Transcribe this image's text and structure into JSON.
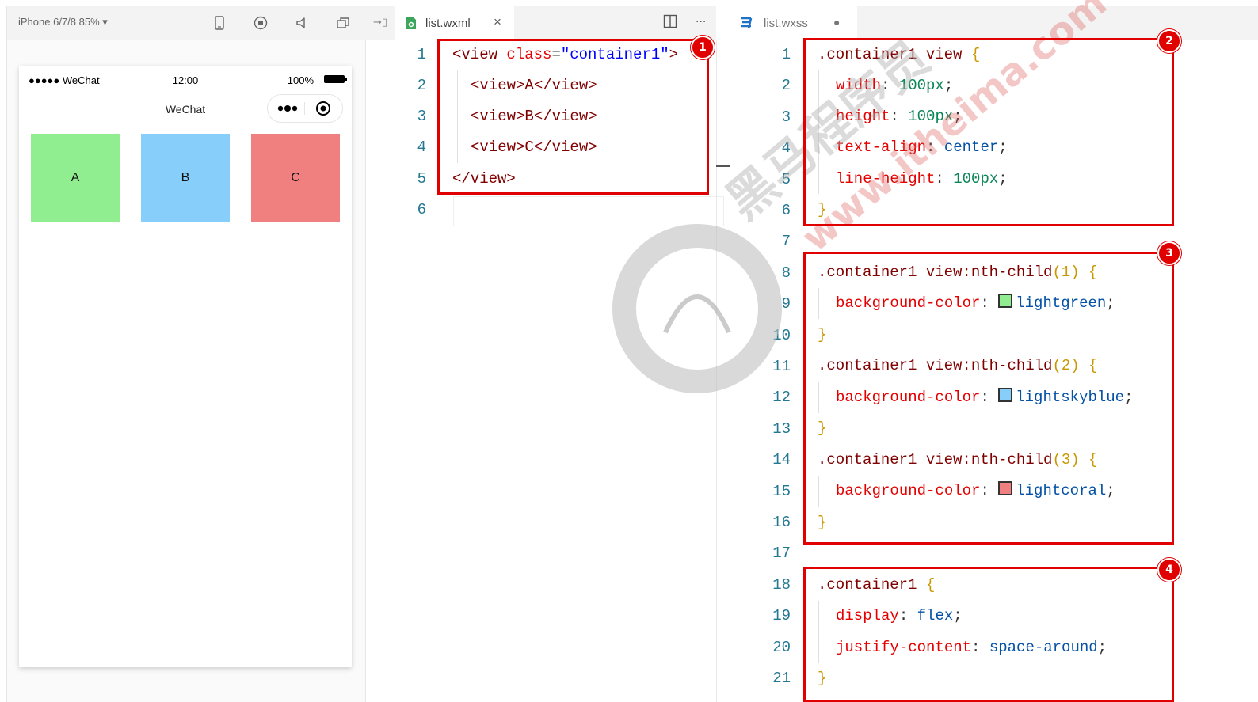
{
  "simulator": {
    "device_label": "iPhone 6/7/8 85% ▾",
    "status": {
      "carrier": "●●●●● WeChat",
      "time": "12:00",
      "battery": "100%"
    },
    "nav_title": "WeChat",
    "boxes": [
      {
        "label": "A",
        "color": "#90ee90"
      },
      {
        "label": "B",
        "color": "#87cefa"
      },
      {
        "label": "C",
        "color": "#f08080"
      }
    ]
  },
  "wxml_editor": {
    "tab": {
      "label": "list.wxml",
      "close": "×"
    },
    "line_numbers": [
      "1",
      "2",
      "3",
      "4",
      "5",
      "6"
    ],
    "code": {
      "l1": {
        "open": "<view ",
        "attr": "class",
        "eq": "=",
        "value": "\"container1\"",
        "close": ">"
      },
      "l2": "<view>A</view>",
      "l3": "<view>B</view>",
      "l4": "<view>C</view>",
      "l5": "</view>"
    },
    "more": "···"
  },
  "wxss_editor": {
    "tab": {
      "label": "list.wxss",
      "modified": "●"
    },
    "line_numbers": [
      "1",
      "2",
      "3",
      "4",
      "5",
      "6",
      "7",
      "8",
      "9",
      "10",
      "11",
      "12",
      "13",
      "14",
      "15",
      "16",
      "17",
      "18",
      "19",
      "20",
      "21"
    ],
    "code": {
      "l1_selector": ".container1 view",
      "l2": {
        "prop": "width",
        "value": "100px"
      },
      "l3": {
        "prop": "height",
        "value": "100px"
      },
      "l4": {
        "prop": "text-align",
        "value": "center"
      },
      "l5": {
        "prop": "line-height",
        "value": "100px"
      },
      "l8_selector": ".container1 view:nth-child",
      "l8_arg": "(1)",
      "l9": {
        "prop": "background-color",
        "value": "lightgreen",
        "swatch": "#90ee90"
      },
      "l11_selector": ".container1 view:nth-child",
      "l11_arg": "(2)",
      "l12": {
        "prop": "background-color",
        "value": "lightskyblue",
        "swatch": "#87cefa"
      },
      "l14_selector": ".container1 view:nth-child",
      "l14_arg": "(3)",
      "l15": {
        "prop": "background-color",
        "value": "lightcoral",
        "swatch": "#f08080"
      },
      "l18_selector": ".container1",
      "l19": {
        "prop": "display",
        "value": "flex"
      },
      "l20": {
        "prop": "justify-content",
        "value": "space-around"
      },
      "open_brace": "{",
      "close_brace": "}",
      "colon": ": ",
      "semi": ";"
    }
  },
  "annotations": [
    "1",
    "2",
    "3",
    "4"
  ],
  "watermark": {
    "text": "www.itheima.com",
    "brand": "黑马程序员"
  },
  "colors": {
    "annotation_red": "#e00000",
    "line_number": "#237893"
  }
}
